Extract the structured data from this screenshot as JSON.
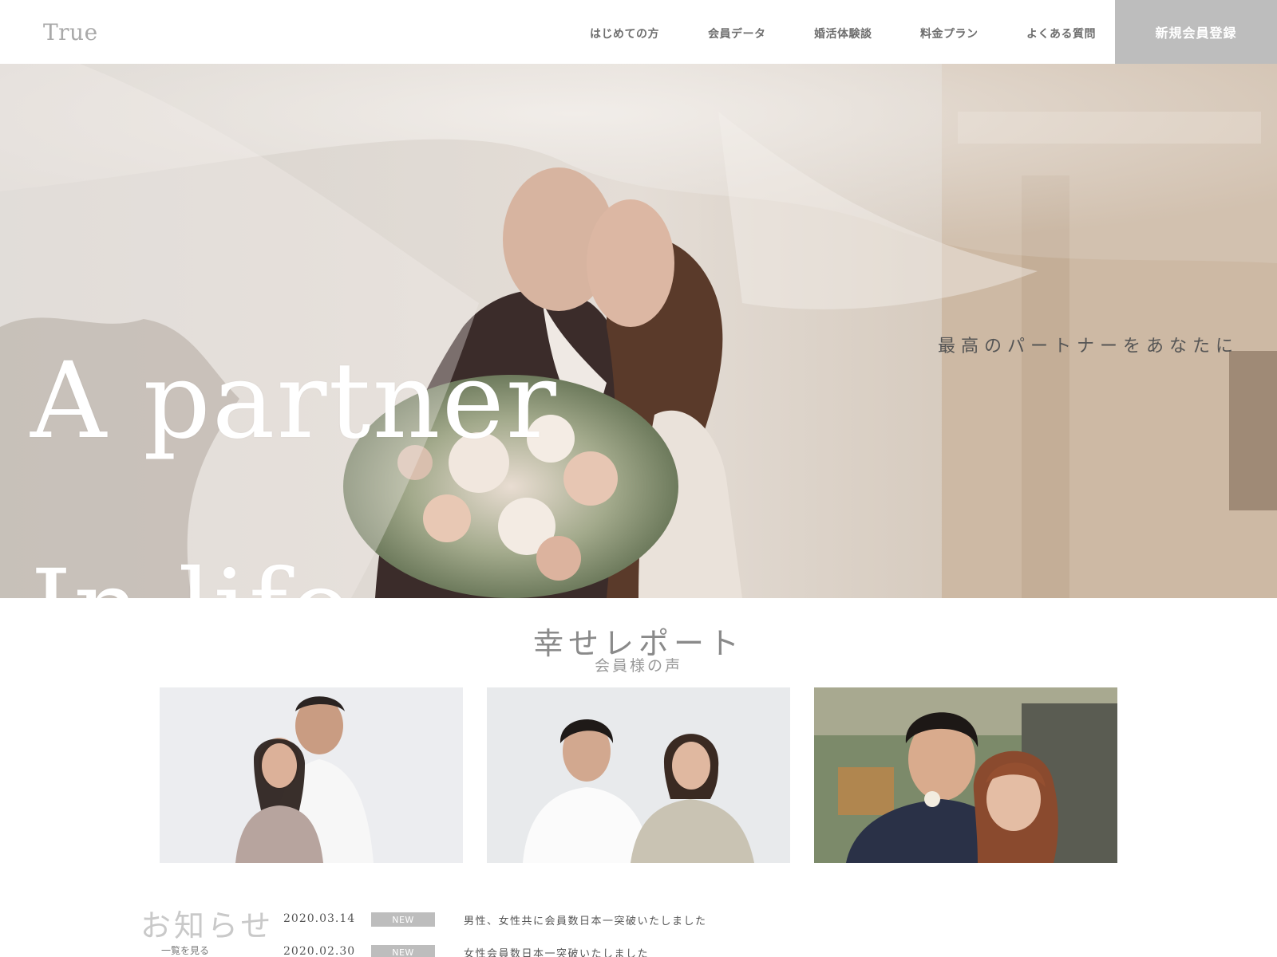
{
  "header": {
    "logo": "True",
    "nav": [
      {
        "label": "はじめての方"
      },
      {
        "label": "会員データ"
      },
      {
        "label": "婚活体験談"
      },
      {
        "label": "料金プラン"
      },
      {
        "label": "よくある質問"
      }
    ],
    "register_label": "新規会員登録"
  },
  "hero": {
    "title_line1": "A partner",
    "title_line2": "In life",
    "subtitle": "最高のパートナーをあなたに"
  },
  "reports": {
    "title": "幸せレポート",
    "subtitle": "会員様の声",
    "cards": [
      {
        "image": "couple-photo-1"
      },
      {
        "image": "couple-photo-2"
      },
      {
        "image": "couple-photo-3"
      }
    ]
  },
  "news": {
    "title": "お知らせ",
    "more_label": "一覧を見る",
    "items": [
      {
        "date": "2020.03.14",
        "badge": "NEW",
        "text": "男性、女性共に会員数日本一突破いたしました"
      },
      {
        "date": "2020.02.30",
        "badge": "NEW",
        "text": "女性会員数日本一突破いたしました"
      }
    ]
  },
  "colors": {
    "register_bg": "#bdbdbd",
    "badge_bg": "#bdbdbd",
    "logo": "#a9a9a9"
  }
}
